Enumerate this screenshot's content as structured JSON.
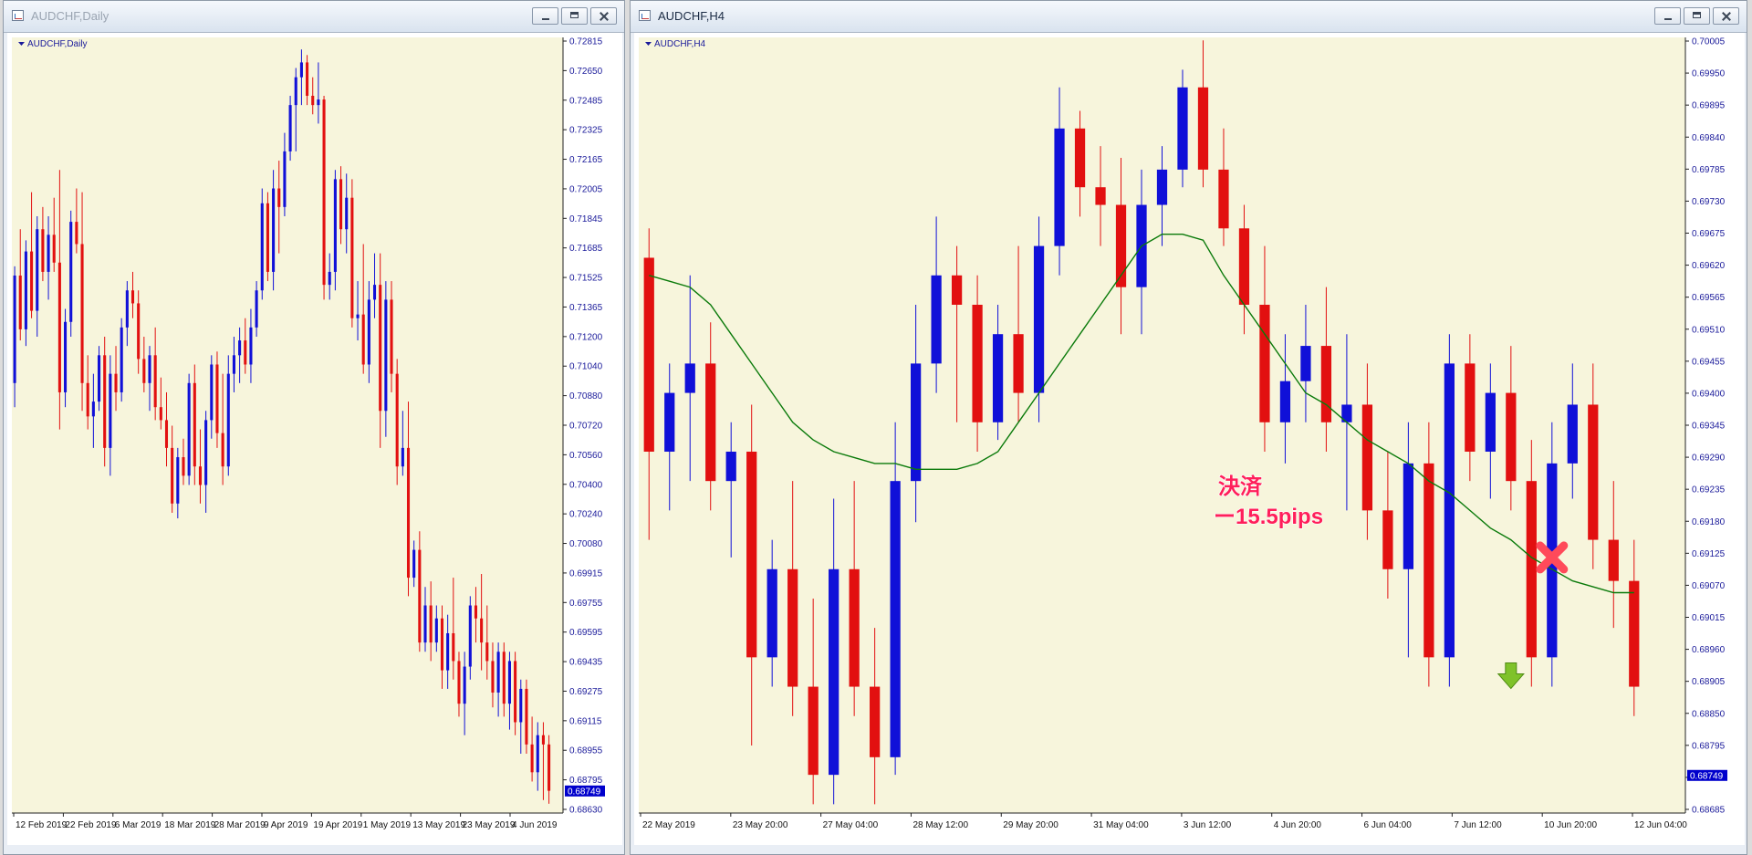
{
  "windows": [
    {
      "title": "AUDCHF,Daily",
      "active": false
    },
    {
      "title": "AUDCHF,H4",
      "active": true
    }
  ],
  "colors": {
    "chart_bg": "#f7f5dc",
    "bull": "#1010d8",
    "bear": "#e21010",
    "wick_bull": "#1010d8",
    "wick_bear": "#e21010",
    "axis_text": "#1a1a9a",
    "moving_average": "#0a7a0a",
    "price_tag_bg": "#0000cc",
    "annotation_text": "#ff1f5a"
  },
  "icons": {
    "close_marker": "red-x-icon",
    "entry_marker": "green-down-arrow-icon"
  },
  "chart_data": [
    {
      "type": "candlestick",
      "title": "AUDCHF,Daily",
      "y_ticks": [
        "0.72815",
        "0.72650",
        "0.72485",
        "0.72325",
        "0.72165",
        "0.72005",
        "0.71845",
        "0.71685",
        "0.71525",
        "0.71365",
        "0.71200",
        "0.71040",
        "0.70880",
        "0.70720",
        "0.70560",
        "0.70400",
        "0.70240",
        "0.70080",
        "0.69915",
        "0.69755",
        "0.69595",
        "0.69435",
        "0.69275",
        "0.69115",
        "0.68955",
        "0.68795",
        "0.68630"
      ],
      "x_ticks": [
        "12 Feb 2019",
        "22 Feb 2019",
        "6 Mar 2019",
        "18 Mar 2019",
        "28 Mar 2019",
        "9 Apr 2019",
        "19 Apr 2019",
        "1 May 2019",
        "13 May 2019",
        "23 May 2019",
        "4 Jun 2019"
      ],
      "current_price": "0.68749",
      "ylim": [
        0.6863,
        0.72815
      ],
      "candles": [
        [
          0.7095,
          0.7158,
          0.7082,
          0.7153
        ],
        [
          0.7153,
          0.7178,
          0.7118,
          0.7124
        ],
        [
          0.7124,
          0.7172,
          0.7115,
          0.7166
        ],
        [
          0.7166,
          0.7198,
          0.713,
          0.7134
        ],
        [
          0.7134,
          0.7185,
          0.712,
          0.7178
        ],
        [
          0.7178,
          0.719,
          0.715,
          0.7155
        ],
        [
          0.7155,
          0.7185,
          0.714,
          0.7175
        ],
        [
          0.7175,
          0.7195,
          0.7155,
          0.716
        ],
        [
          0.716,
          0.721,
          0.707,
          0.709
        ],
        [
          0.709,
          0.7135,
          0.7082,
          0.7128
        ],
        [
          0.7128,
          0.7188,
          0.712,
          0.7182
        ],
        [
          0.7182,
          0.72,
          0.7165,
          0.717
        ],
        [
          0.717,
          0.7198,
          0.708,
          0.7095
        ],
        [
          0.7095,
          0.711,
          0.707,
          0.7077
        ],
        [
          0.7077,
          0.71,
          0.706,
          0.7085
        ],
        [
          0.7085,
          0.7115,
          0.708,
          0.711
        ],
        [
          0.711,
          0.712,
          0.705,
          0.706
        ],
        [
          0.706,
          0.711,
          0.7045,
          0.71
        ],
        [
          0.71,
          0.7115,
          0.708,
          0.709
        ],
        [
          0.709,
          0.713,
          0.7085,
          0.7125
        ],
        [
          0.7125,
          0.715,
          0.7115,
          0.7145
        ],
        [
          0.7145,
          0.7155,
          0.713,
          0.7138
        ],
        [
          0.7138,
          0.7145,
          0.71,
          0.7108
        ],
        [
          0.7108,
          0.712,
          0.709,
          0.7095
        ],
        [
          0.7095,
          0.7115,
          0.708,
          0.711
        ],
        [
          0.711,
          0.7125,
          0.7075,
          0.7082
        ],
        [
          0.7082,
          0.7098,
          0.707,
          0.7075
        ],
        [
          0.7075,
          0.709,
          0.705,
          0.706
        ],
        [
          0.706,
          0.7072,
          0.7025,
          0.703
        ],
        [
          0.703,
          0.706,
          0.7022,
          0.7055
        ],
        [
          0.7055,
          0.7065,
          0.704,
          0.7045
        ],
        [
          0.7045,
          0.71,
          0.704,
          0.7095
        ],
        [
          0.7095,
          0.7105,
          0.704,
          0.705
        ],
        [
          0.705,
          0.707,
          0.703,
          0.704
        ],
        [
          0.704,
          0.708,
          0.7025,
          0.7075
        ],
        [
          0.7075,
          0.711,
          0.7065,
          0.7105
        ],
        [
          0.7105,
          0.7112,
          0.706,
          0.7068
        ],
        [
          0.7068,
          0.71,
          0.704,
          0.705
        ],
        [
          0.705,
          0.711,
          0.7045,
          0.71
        ],
        [
          0.71,
          0.712,
          0.709,
          0.711
        ],
        [
          0.711,
          0.7125,
          0.7095,
          0.7118
        ],
        [
          0.7118,
          0.713,
          0.71,
          0.7105
        ],
        [
          0.7105,
          0.7135,
          0.7095,
          0.7125
        ],
        [
          0.7125,
          0.715,
          0.712,
          0.7145
        ],
        [
          0.7145,
          0.72,
          0.714,
          0.7192
        ],
        [
          0.7192,
          0.7198,
          0.715,
          0.7155
        ],
        [
          0.7155,
          0.721,
          0.7145,
          0.72
        ],
        [
          0.72,
          0.7215,
          0.7165,
          0.719
        ],
        [
          0.719,
          0.723,
          0.7185,
          0.722
        ],
        [
          0.722,
          0.725,
          0.7215,
          0.7245
        ],
        [
          0.7245,
          0.7265,
          0.722,
          0.726
        ],
        [
          0.726,
          0.7275,
          0.7245,
          0.7268
        ],
        [
          0.7268,
          0.7272,
          0.7245,
          0.725
        ],
        [
          0.725,
          0.726,
          0.724,
          0.7245
        ],
        [
          0.7245,
          0.7268,
          0.7235,
          0.7248
        ],
        [
          0.7248,
          0.725,
          0.714,
          0.7148
        ],
        [
          0.7148,
          0.7165,
          0.714,
          0.7155
        ],
        [
          0.7155,
          0.721,
          0.7145,
          0.7205
        ],
        [
          0.7205,
          0.7212,
          0.717,
          0.7178
        ],
        [
          0.7178,
          0.7208,
          0.7165,
          0.7195
        ],
        [
          0.7195,
          0.7205,
          0.7125,
          0.713
        ],
        [
          0.713,
          0.715,
          0.7118,
          0.7132
        ],
        [
          0.7132,
          0.717,
          0.71,
          0.7105
        ],
        [
          0.7105,
          0.715,
          0.7095,
          0.714
        ],
        [
          0.714,
          0.7165,
          0.713,
          0.7148
        ],
        [
          0.7148,
          0.7165,
          0.706,
          0.708
        ],
        [
          0.708,
          0.715,
          0.7066,
          0.714
        ],
        [
          0.714,
          0.715,
          0.709,
          0.71
        ],
        [
          0.71,
          0.7108,
          0.704,
          0.705
        ],
        [
          0.705,
          0.708,
          0.7045,
          0.706
        ],
        [
          0.706,
          0.7085,
          0.698,
          0.699
        ],
        [
          0.699,
          0.701,
          0.6985,
          0.7005
        ],
        [
          0.7005,
          0.7015,
          0.695,
          0.6955
        ],
        [
          0.6955,
          0.6985,
          0.695,
          0.6975
        ],
        [
          0.6975,
          0.6988,
          0.6945,
          0.6955
        ],
        [
          0.6955,
          0.6975,
          0.695,
          0.6968
        ],
        [
          0.6968,
          0.6975,
          0.693,
          0.694
        ],
        [
          0.694,
          0.697,
          0.693,
          0.696
        ],
        [
          0.696,
          0.699,
          0.6935,
          0.6945
        ],
        [
          0.6945,
          0.695,
          0.6915,
          0.6922
        ],
        [
          0.6922,
          0.695,
          0.6905,
          0.6942
        ],
        [
          0.6942,
          0.698,
          0.6935,
          0.6975
        ],
        [
          0.6975,
          0.6985,
          0.6955,
          0.6968
        ],
        [
          0.6968,
          0.6992,
          0.694,
          0.6955
        ],
        [
          0.6955,
          0.6975,
          0.6935,
          0.6945
        ],
        [
          0.6945,
          0.6955,
          0.692,
          0.6928
        ],
        [
          0.6928,
          0.6955,
          0.6915,
          0.695
        ],
        [
          0.695,
          0.6955,
          0.6915,
          0.6922
        ],
        [
          0.6922,
          0.695,
          0.6908,
          0.6945
        ],
        [
          0.6945,
          0.695,
          0.6905,
          0.6912
        ],
        [
          0.6912,
          0.6935,
          0.6895,
          0.693
        ],
        [
          0.693,
          0.6935,
          0.6895,
          0.69
        ],
        [
          0.69,
          0.6915,
          0.688,
          0.6885
        ],
        [
          0.6885,
          0.6912,
          0.6875,
          0.6905
        ],
        [
          0.6905,
          0.6912,
          0.687,
          0.69
        ],
        [
          0.69,
          0.6905,
          0.6868,
          0.6875
        ]
      ]
    },
    {
      "type": "candlestick",
      "title": "AUDCHF,H4",
      "y_ticks": [
        "0.70005",
        "0.69950",
        "0.69895",
        "0.69840",
        "0.69785",
        "0.69730",
        "0.69675",
        "0.69620",
        "0.69565",
        "0.69510",
        "0.69455",
        "0.69400",
        "0.69345",
        "0.69290",
        "0.69235",
        "0.69180",
        "0.69125",
        "0.69070",
        "0.69015",
        "0.68960",
        "0.68905",
        "0.68850",
        "0.68795",
        "0.68740",
        "0.68685"
      ],
      "x_ticks": [
        "22 May 2019",
        "23 May 20:00",
        "27 May 04:00",
        "28 May 12:00",
        "29 May 20:00",
        "31 May 04:00",
        "3 Jun 12:00",
        "4 Jun 20:00",
        "6 Jun 04:00",
        "7 Jun 12:00",
        "10 Jun 20:00",
        "12 Jun 04:00"
      ],
      "current_price": "0.68749",
      "ylim": [
        0.68685,
        0.70005
      ],
      "series": [
        {
          "type": "line",
          "values": [
            0.696,
            0.6959,
            0.6958,
            0.6955,
            0.695,
            0.6945,
            0.694,
            0.6935,
            0.6932,
            0.693,
            0.6929,
            0.6928,
            0.6928,
            0.6927,
            0.6927,
            0.6927,
            0.6928,
            0.693,
            0.6935,
            0.694,
            0.6945,
            0.695,
            0.6955,
            0.696,
            0.6965,
            0.6967,
            0.6967,
            0.6966,
            0.696,
            0.6955,
            0.695,
            0.6945,
            0.694,
            0.6938,
            0.6935,
            0.6932,
            0.693,
            0.6928,
            0.6925,
            0.6923,
            0.692,
            0.6917,
            0.6915,
            0.6912,
            0.691,
            0.6908,
            0.6907,
            0.6906,
            0.6906
          ]
        }
      ],
      "candles": [
        [
          0.6963,
          0.6968,
          0.6915,
          0.693
        ],
        [
          0.693,
          0.6945,
          0.692,
          0.694
        ],
        [
          0.694,
          0.696,
          0.6925,
          0.6945
        ],
        [
          0.6945,
          0.6952,
          0.692,
          0.6925
        ],
        [
          0.6925,
          0.6935,
          0.6912,
          0.693
        ],
        [
          0.693,
          0.6938,
          0.688,
          0.6895
        ],
        [
          0.6895,
          0.6915,
          0.689,
          0.691
        ],
        [
          0.691,
          0.6925,
          0.6885,
          0.689
        ],
        [
          0.689,
          0.6905,
          0.687,
          0.6875
        ],
        [
          0.6875,
          0.6922,
          0.687,
          0.691
        ],
        [
          0.691,
          0.6925,
          0.6885,
          0.689
        ],
        [
          0.689,
          0.69,
          0.687,
          0.6878
        ],
        [
          0.6878,
          0.6935,
          0.6875,
          0.6925
        ],
        [
          0.6925,
          0.6955,
          0.6918,
          0.6945
        ],
        [
          0.6945,
          0.697,
          0.694,
          0.696
        ],
        [
          0.696,
          0.6965,
          0.6935,
          0.6955
        ],
        [
          0.6955,
          0.696,
          0.693,
          0.6935
        ],
        [
          0.6935,
          0.6955,
          0.6932,
          0.695
        ],
        [
          0.695,
          0.6965,
          0.6935,
          0.694
        ],
        [
          0.694,
          0.697,
          0.6935,
          0.6965
        ],
        [
          0.6965,
          0.6992,
          0.696,
          0.6985
        ],
        [
          0.6985,
          0.6988,
          0.697,
          0.6975
        ],
        [
          0.6975,
          0.6982,
          0.6965,
          0.6972
        ],
        [
          0.6972,
          0.698,
          0.695,
          0.6958
        ],
        [
          0.6958,
          0.6978,
          0.695,
          0.6972
        ],
        [
          0.6972,
          0.6982,
          0.6965,
          0.6978
        ],
        [
          0.6978,
          0.6995,
          0.6975,
          0.6992
        ],
        [
          0.6992,
          0.7,
          0.6975,
          0.6978
        ],
        [
          0.6978,
          0.6985,
          0.6965,
          0.6968
        ],
        [
          0.6968,
          0.6972,
          0.695,
          0.6955
        ],
        [
          0.6955,
          0.6965,
          0.693,
          0.6935
        ],
        [
          0.6935,
          0.695,
          0.6928,
          0.6942
        ],
        [
          0.6942,
          0.6955,
          0.6935,
          0.6948
        ],
        [
          0.6948,
          0.6958,
          0.693,
          0.6935
        ],
        [
          0.6935,
          0.695,
          0.692,
          0.6938
        ],
        [
          0.6938,
          0.6945,
          0.6915,
          0.692
        ],
        [
          0.692,
          0.693,
          0.6905,
          0.691
        ],
        [
          0.691,
          0.6935,
          0.6895,
          0.6928
        ],
        [
          0.6928,
          0.6935,
          0.689,
          0.6895
        ],
        [
          0.6895,
          0.695,
          0.689,
          0.6945
        ],
        [
          0.6945,
          0.695,
          0.6925,
          0.693
        ],
        [
          0.693,
          0.6945,
          0.6922,
          0.694
        ],
        [
          0.694,
          0.6948,
          0.692,
          0.6925
        ],
        [
          0.6925,
          0.6932,
          0.689,
          0.6895
        ],
        [
          0.6895,
          0.6935,
          0.689,
          0.6928
        ],
        [
          0.6928,
          0.6945,
          0.6922,
          0.6938
        ],
        [
          0.6938,
          0.6945,
          0.691,
          0.6915
        ],
        [
          0.6915,
          0.6925,
          0.69,
          0.6908
        ],
        [
          0.6908,
          0.6915,
          0.6885,
          0.689
        ]
      ]
    }
  ],
  "annotations": {
    "settle_label": "決済",
    "pips_label": "ー15.5pips"
  }
}
